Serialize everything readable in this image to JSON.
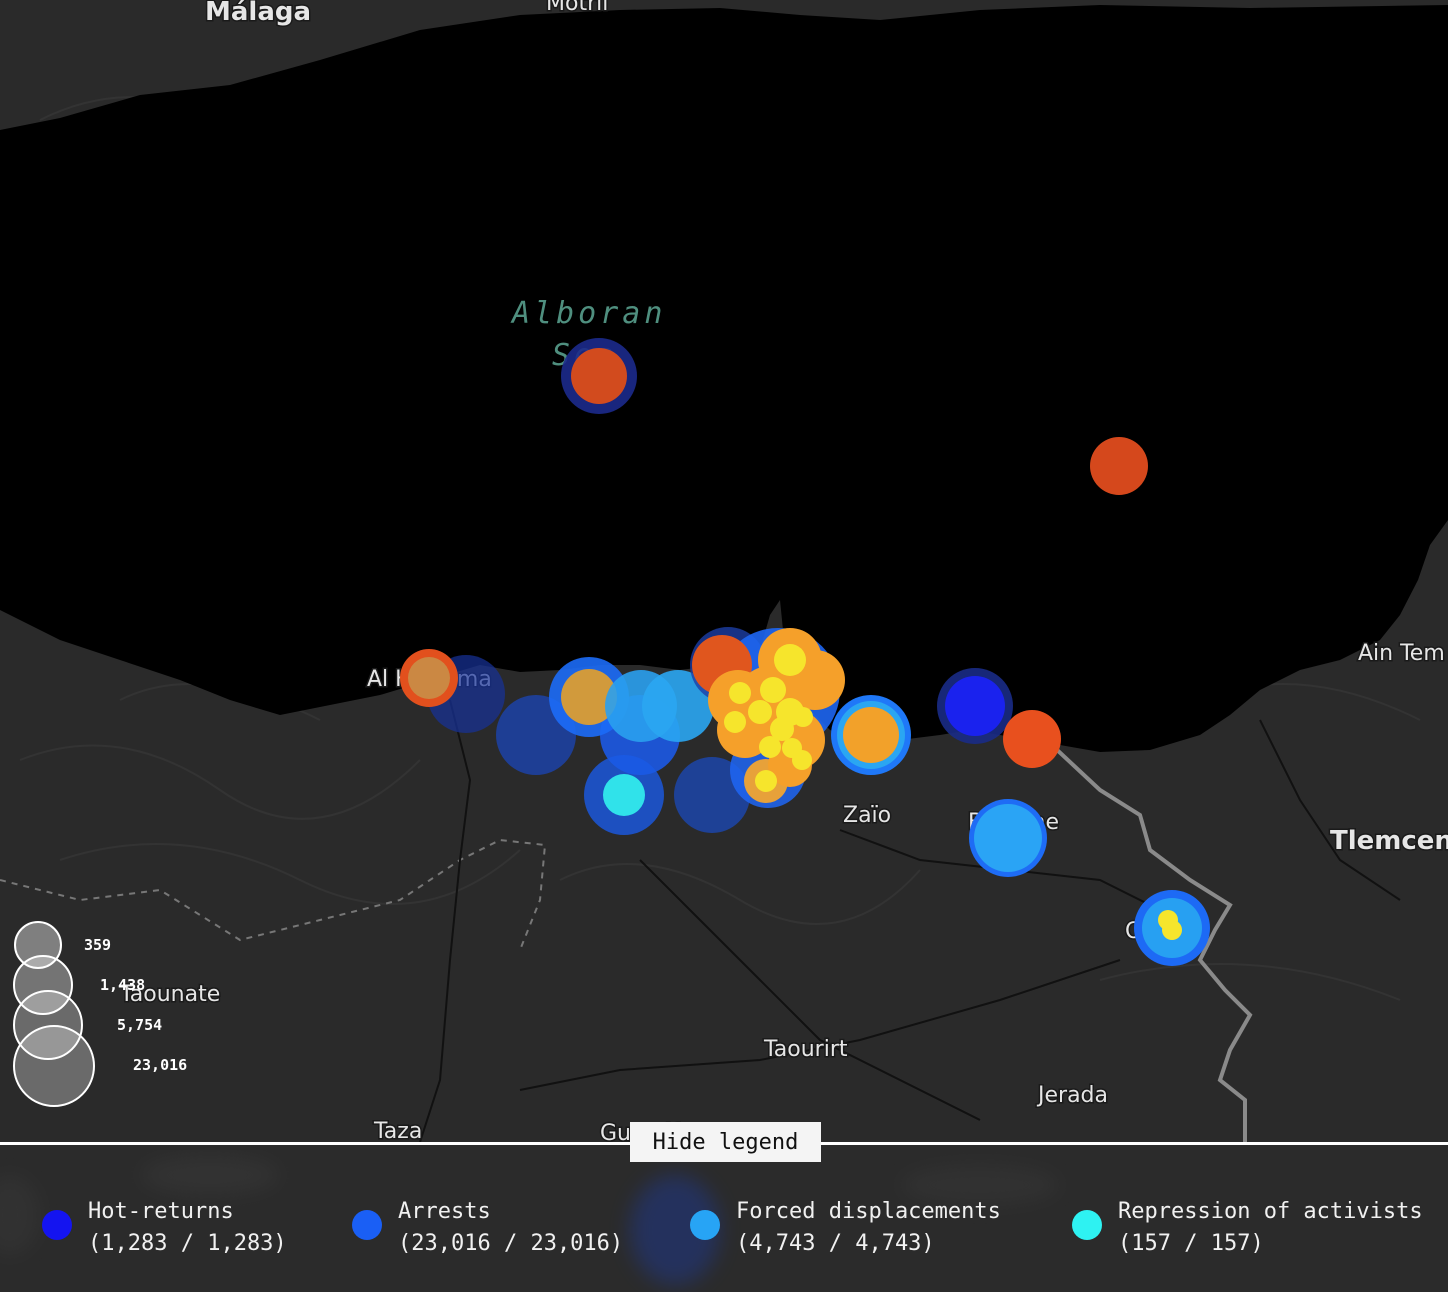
{
  "map": {
    "sea_label": "Alboran Sea",
    "sea_label_lines": [
      "Alboran",
      "Sea"
    ],
    "places": {
      "malaga": "Málaga",
      "motril": "Motril",
      "al_hoceima": "Al Hoceima",
      "ain_tem": "Ain Tem",
      "zaio": "Zaïo",
      "berkane": "Berkane",
      "tlemcen": "Tlemcen",
      "oujda": "Oujda",
      "taounate": "Taounate",
      "taourirt": "Taourirt",
      "jerada": "Jerada",
      "taza": "Taza",
      "guercif": "Guercif"
    },
    "marker_colors": {
      "hot_returns": "#1f24f5",
      "arrests": "#1e5fff",
      "forced_displacements": "#21a1f4",
      "repression_of_activists": "#2ee9ee",
      "orange": "#f5a02a",
      "red_orange": "#e2501d",
      "yellow": "#f4e62a"
    }
  },
  "size_scale": {
    "values": [
      "359",
      "1,438",
      "5,754",
      "23,016"
    ]
  },
  "legend": {
    "toggle_label": "Hide legend",
    "items": [
      {
        "label": "Hot-returns",
        "count": "(1,283 / 1,283)",
        "color": "#1414f0"
      },
      {
        "label": "Arrests",
        "count": "(23,016 / 23,016)",
        "color": "#1a5ff5"
      },
      {
        "label": "Forced displacements",
        "count": "(4,743 / 4,743)",
        "color": "#27a4f5"
      },
      {
        "label": "Repression of activists",
        "count": "(157 / 157)",
        "color": "#2ef2f2"
      }
    ]
  }
}
